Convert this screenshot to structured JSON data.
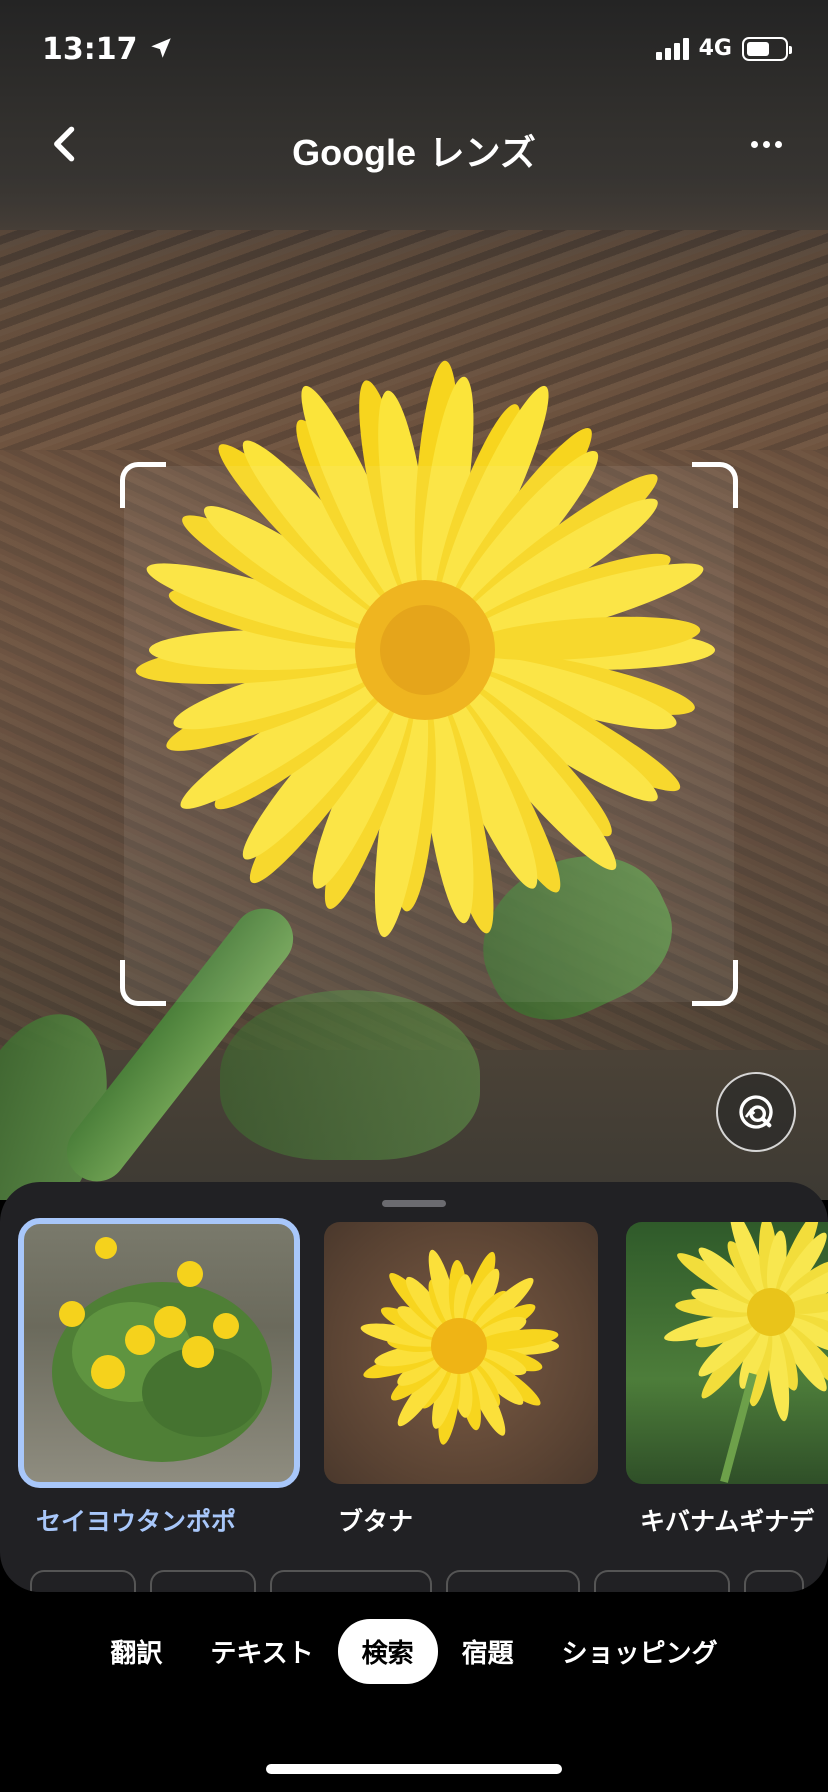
{
  "status_bar": {
    "time": "13:17",
    "network": "4G"
  },
  "header": {
    "brand": "Google",
    "title_suffix": "レンズ"
  },
  "results": [
    {
      "label": "セイヨウタンポポ",
      "selected": true
    },
    {
      "label": "ブタナ",
      "selected": false
    },
    {
      "label": "キバナムギナデ",
      "selected": false
    }
  ],
  "modes": [
    {
      "label": "翻訳",
      "active": false
    },
    {
      "label": "テキスト",
      "active": false
    },
    {
      "label": "検索",
      "active": true
    },
    {
      "label": "宿題",
      "active": false
    },
    {
      "label": "ショッピング",
      "active": false
    }
  ],
  "colors": {
    "accent": "#a8c7fa",
    "sheet": "#212124",
    "flower": "#f7d51e"
  }
}
